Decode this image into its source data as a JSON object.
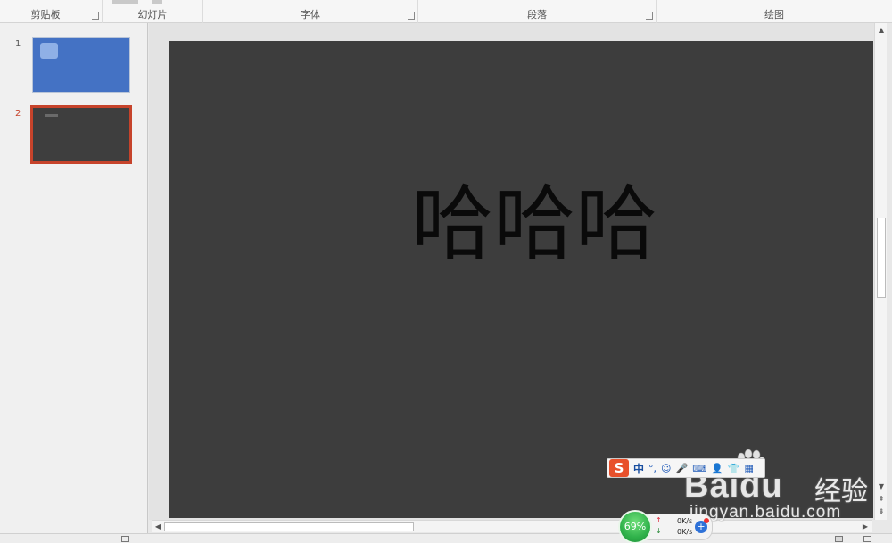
{
  "ribbon": {
    "groups": [
      {
        "label": "剪贴板",
        "launcher": true
      },
      {
        "label": "幻灯片",
        "launcher": false
      },
      {
        "label": "字体",
        "launcher": true
      },
      {
        "label": "段落",
        "launcher": true
      },
      {
        "label": "绘图",
        "launcher": false
      }
    ]
  },
  "thumbnails": [
    {
      "number": "1",
      "background": "#4472c4",
      "selected": false
    },
    {
      "number": "2",
      "background": "#3e3e3e",
      "selected": true
    }
  ],
  "slide": {
    "text": "哈哈哈",
    "background": "#3d3d3d",
    "text_color": "#0a0a0a"
  },
  "colors": {
    "selection_border": "#c6432b",
    "ime_logo": "#e8502b"
  },
  "ime": {
    "logo": "S",
    "mode": "中",
    "items": [
      "°,",
      "☺",
      "🎤",
      "⌨",
      "👤",
      "👕",
      "▦"
    ]
  },
  "watermark": {
    "brand": "Bai",
    "brand_end": "du",
    "suffix": "经验",
    "url": "jingyan.baidu.com"
  },
  "network": {
    "percent": "69%",
    "upload": "0K/s",
    "download": "0K/s"
  }
}
